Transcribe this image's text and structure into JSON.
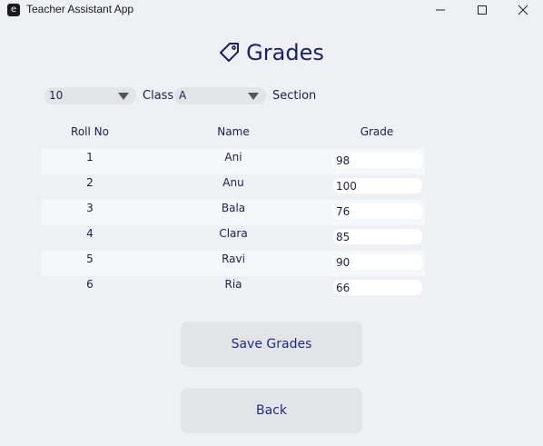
{
  "window": {
    "icon_letter": "e",
    "title": "Teacher Assistant App"
  },
  "header": {
    "title": "Grades",
    "icon": "tag-icon"
  },
  "filters": {
    "class_value": "10",
    "class_label": "Class",
    "section_value": "A",
    "section_label": "Section"
  },
  "table": {
    "columns": [
      "Roll No",
      "Name",
      "Grade"
    ],
    "rows": [
      {
        "roll": "1",
        "name": "Ani",
        "grade": "98"
      },
      {
        "roll": "2",
        "name": "Anu",
        "grade": "100"
      },
      {
        "roll": "3",
        "name": "Bala",
        "grade": "76"
      },
      {
        "roll": "4",
        "name": "Clara",
        "grade": "85"
      },
      {
        "roll": "5",
        "name": "Ravi",
        "grade": "90"
      },
      {
        "roll": "6",
        "name": "Ria",
        "grade": "66"
      }
    ]
  },
  "actions": {
    "save_label": "Save Grades",
    "back_label": "Back"
  },
  "colors": {
    "accent_text": "#1f2a8a",
    "title_text": "#1b1f66",
    "background": "#eef0f3"
  }
}
